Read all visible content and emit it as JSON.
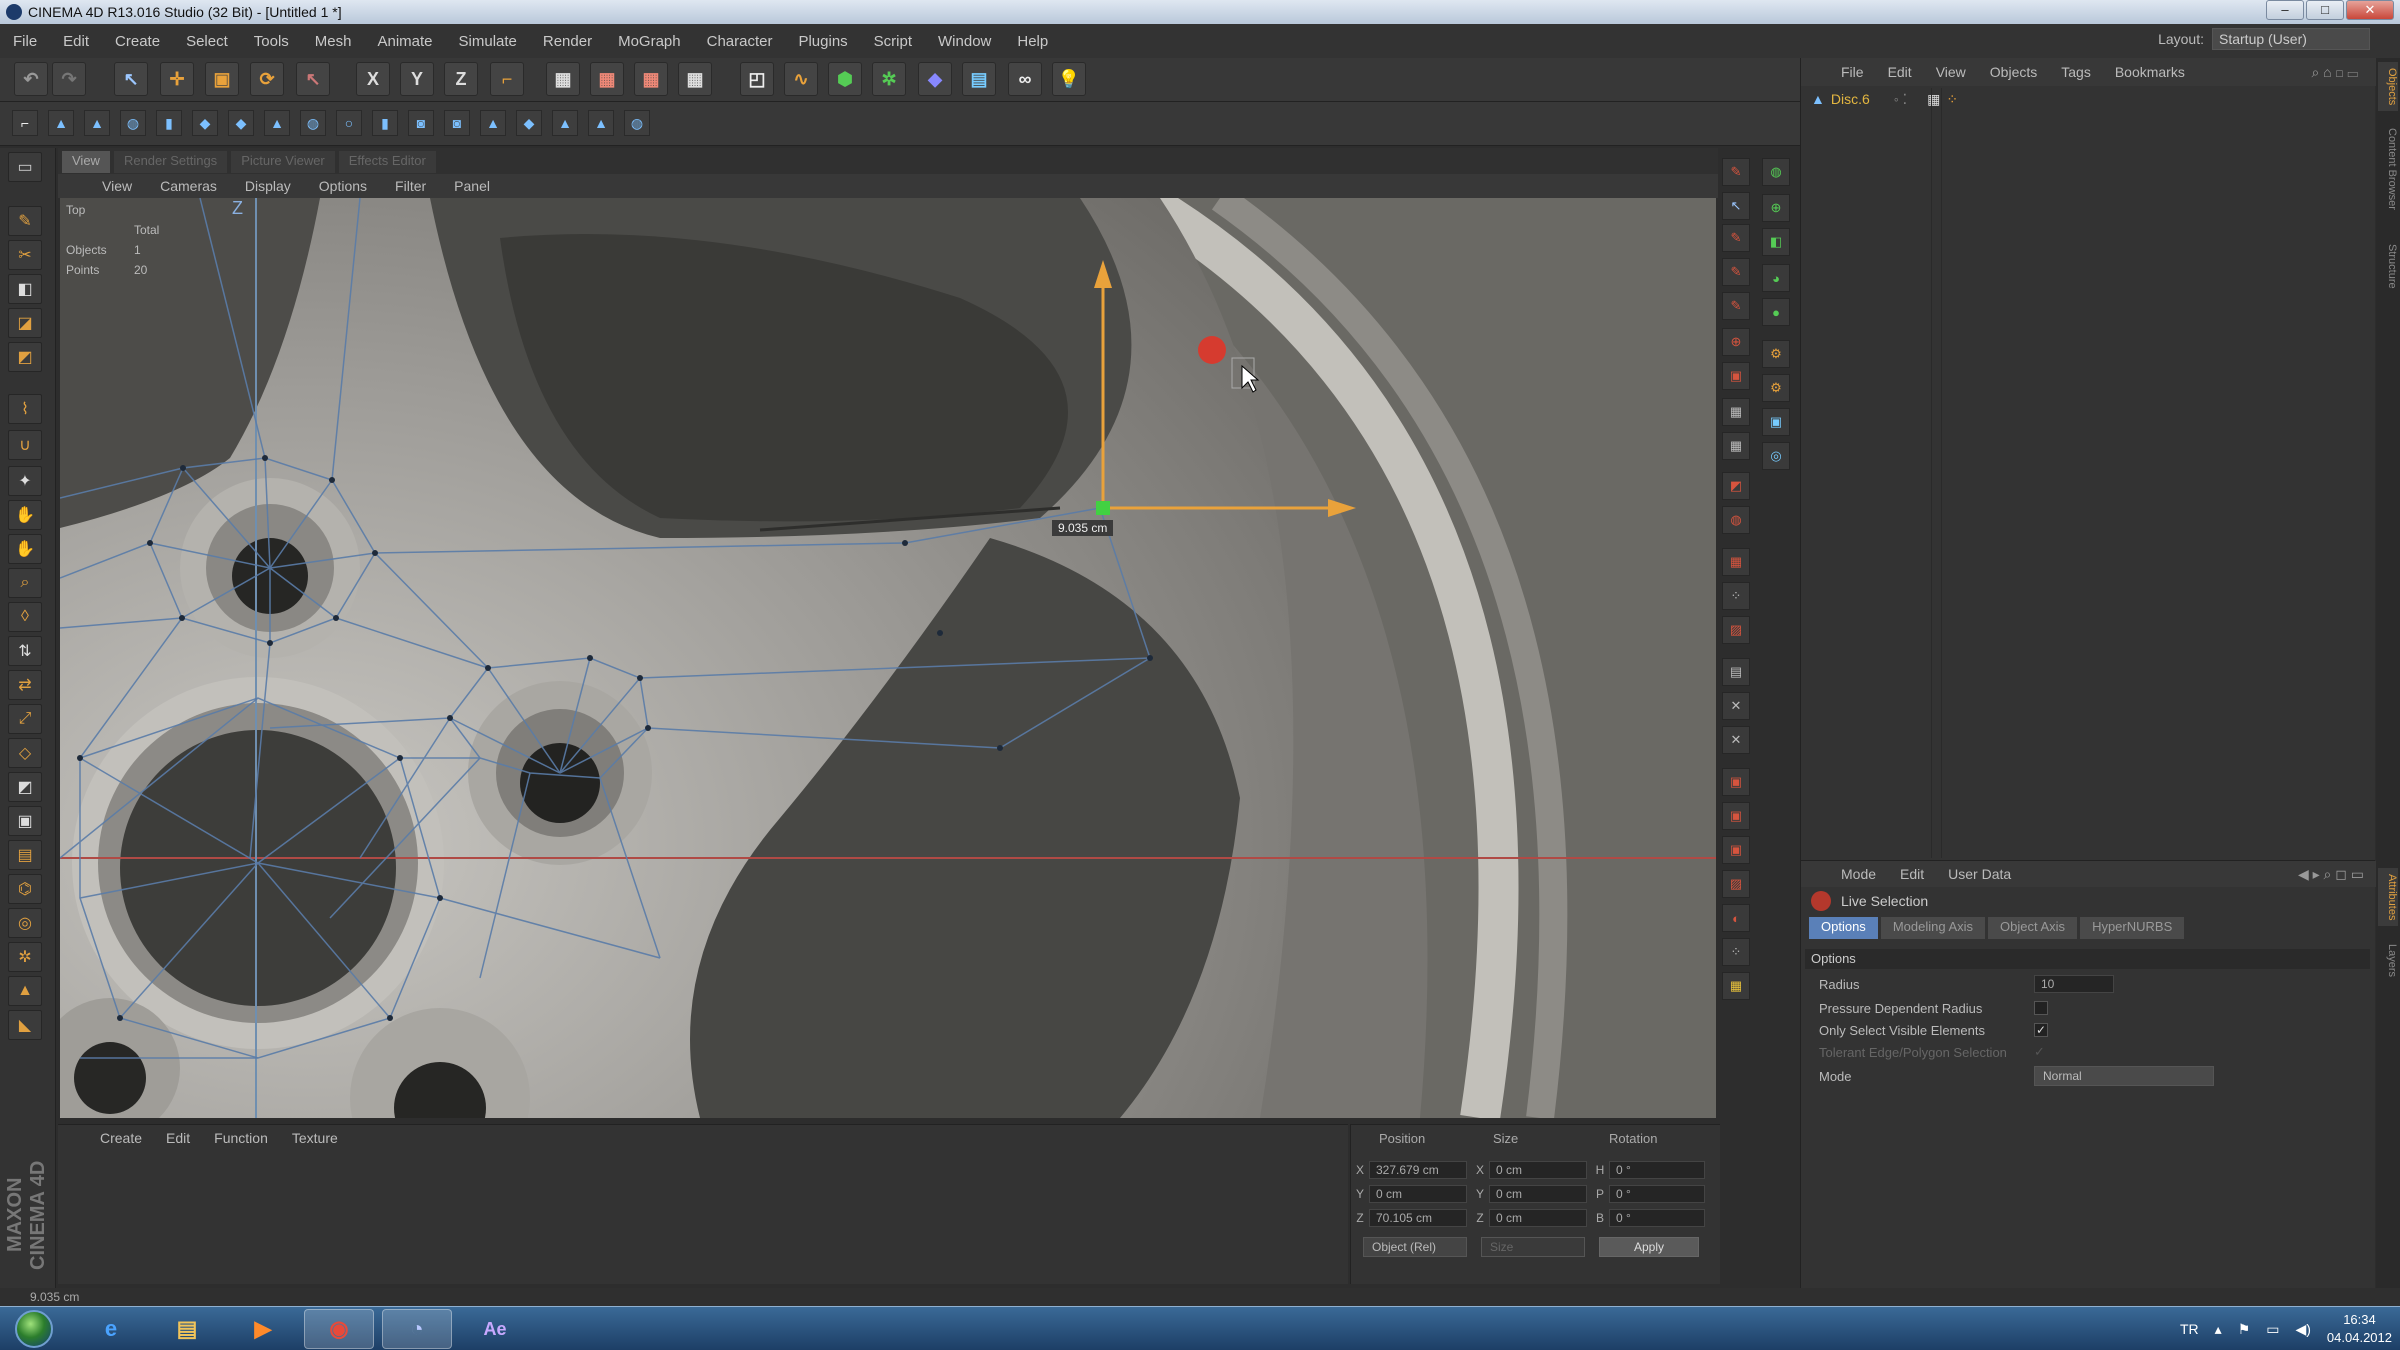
{
  "window": {
    "title": "CINEMA 4D R13.016 Studio (32 Bit) - [Untitled 1 *]"
  },
  "menubar": [
    "File",
    "Edit",
    "Create",
    "Select",
    "Tools",
    "Mesh",
    "Animate",
    "Simulate",
    "Render",
    "MoGraph",
    "Character",
    "Plugins",
    "Script",
    "Window",
    "Help"
  ],
  "layout": {
    "label": "Layout:",
    "value": "Startup (User)"
  },
  "viewport": {
    "tabs": [
      "View",
      "Render Settings",
      "Picture Viewer",
      "Effects Editor"
    ],
    "menu": [
      "View",
      "Cameras",
      "Display",
      "Options",
      "Filter",
      "Panel"
    ],
    "view_name": "Top",
    "hud": {
      "total": "Total",
      "objects_label": "Objects",
      "objects_value": "1",
      "points_label": "Points",
      "points_value": "20"
    },
    "axis_z": "Z",
    "measure_label": "9.035 cm"
  },
  "object_manager": {
    "menu": [
      "File",
      "Edit",
      "View",
      "Objects",
      "Tags",
      "Bookmarks"
    ],
    "object_name": "Disc.6"
  },
  "attributes": {
    "menu": [
      "Mode",
      "Edit",
      "User Data"
    ],
    "tool_name": "Live Selection",
    "tabs": [
      "Options",
      "Modeling Axis",
      "Object Axis",
      "HyperNURBS"
    ],
    "section": "Options",
    "radius_label": "Radius",
    "radius_value": "10",
    "pressure_label": "Pressure Dependent Radius",
    "visible_label": "Only Select Visible Elements",
    "tolerant_label": "Tolerant Edge/Polygon Selection",
    "mode_label": "Mode",
    "mode_value": "Normal"
  },
  "side_tabs": [
    "Objects",
    "Content Browser",
    "Structure",
    "Attributes",
    "Layers"
  ],
  "material_manager": {
    "menu": [
      "Create",
      "Edit",
      "Function",
      "Texture"
    ]
  },
  "coordinates": {
    "headers": [
      "Position",
      "Size",
      "Rotation"
    ],
    "rows": [
      {
        "axis": "X",
        "pos": "327.679 cm",
        "size_axis": "X",
        "size": "0 cm",
        "rot_axis": "H",
        "rot": "0 °"
      },
      {
        "axis": "Y",
        "pos": "0 cm",
        "size_axis": "Y",
        "size": "0 cm",
        "rot_axis": "P",
        "rot": "0 °"
      },
      {
        "axis": "Z",
        "pos": "70.105 cm",
        "size_axis": "Z",
        "size": "0 cm",
        "rot_axis": "B",
        "rot": "0 °"
      }
    ],
    "coord_mode": "Object (Rel)",
    "size_mode": "Size",
    "apply": "Apply"
  },
  "statusbar": {
    "text": "9.035 cm"
  },
  "taskbar": {
    "lang": "TR",
    "time": "16:34",
    "date": "04.04.2012",
    "ae_label": "Ae"
  },
  "colors": {
    "accent_orange": "#e9a23b",
    "selected_point": "#42d142",
    "axis_red": "#d94a3c",
    "tab_blue": "#5a80b8"
  }
}
